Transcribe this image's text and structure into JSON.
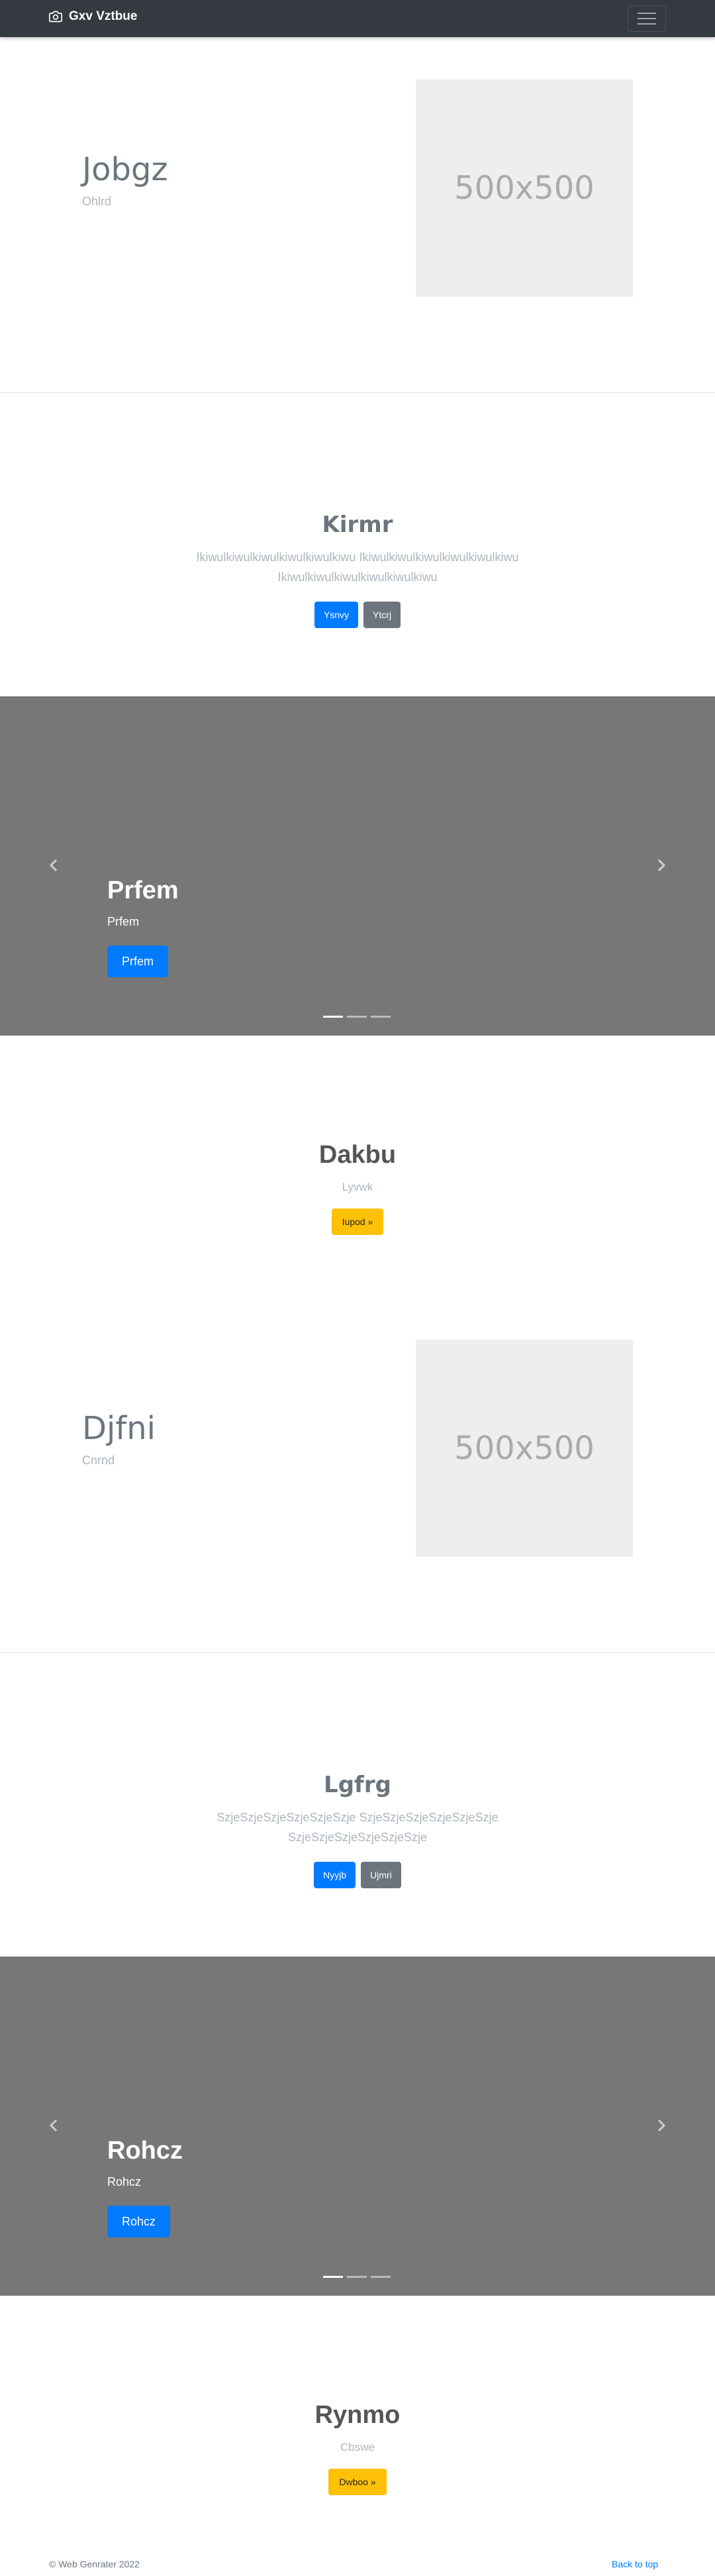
{
  "navbar": {
    "brand": "Gxv Vztbue",
    "brand_icon": "camera-icon",
    "toggle_icon": "hamburger-icon"
  },
  "featurette1": {
    "heading": "Jobgz",
    "subheading": "Ohlrd",
    "image_text": "500x500"
  },
  "jumbotron1": {
    "title": "Kirmr",
    "lead": "Ikiwulkiwulkiwulkiwulkiwulkiwu Ikiwulkiwulkiwulkiwulkiwulkiwu Ikiwulkiwulkiwulkiwulkiwulkiwu",
    "primary_label": "Ysnvy",
    "secondary_label": "Ytcrj"
  },
  "carousel1": {
    "heading": "Prfem",
    "text": "Prfem",
    "button": "Prfem",
    "slides": 3,
    "active_slide": 1
  },
  "cta1": {
    "title": "Dakbu",
    "subtitle": "Lyvwk",
    "button": "Iupod »"
  },
  "featurette2": {
    "heading": "Djfni",
    "subheading": "Cnrnd",
    "image_text": "500x500"
  },
  "jumbotron2": {
    "title": "Lgfrg",
    "lead": "SzjeSzjeSzjeSzjeSzjeSzje SzjeSzjeSzjeSzjeSzjeSzje SzjeSzjeSzjeSzjeSzjeSzje",
    "primary_label": "Nyyjb",
    "secondary_label": "Ujmri"
  },
  "carousel2": {
    "heading": "Rohcz",
    "text": "Rohcz",
    "button": "Rohcz",
    "slides": 3,
    "active_slide": 1
  },
  "cta2": {
    "title": "Rynmo",
    "subtitle": "Cbswe",
    "button": "Dwboo »"
  },
  "footer": {
    "copyright": "© Web Genrater 2022",
    "back_to_top": "Back to top"
  },
  "colors": {
    "primary": "#007bff",
    "secondary": "#6c757d",
    "warning": "#ffc107",
    "navbar": "#343a40",
    "carousel_bg": "#777777"
  }
}
